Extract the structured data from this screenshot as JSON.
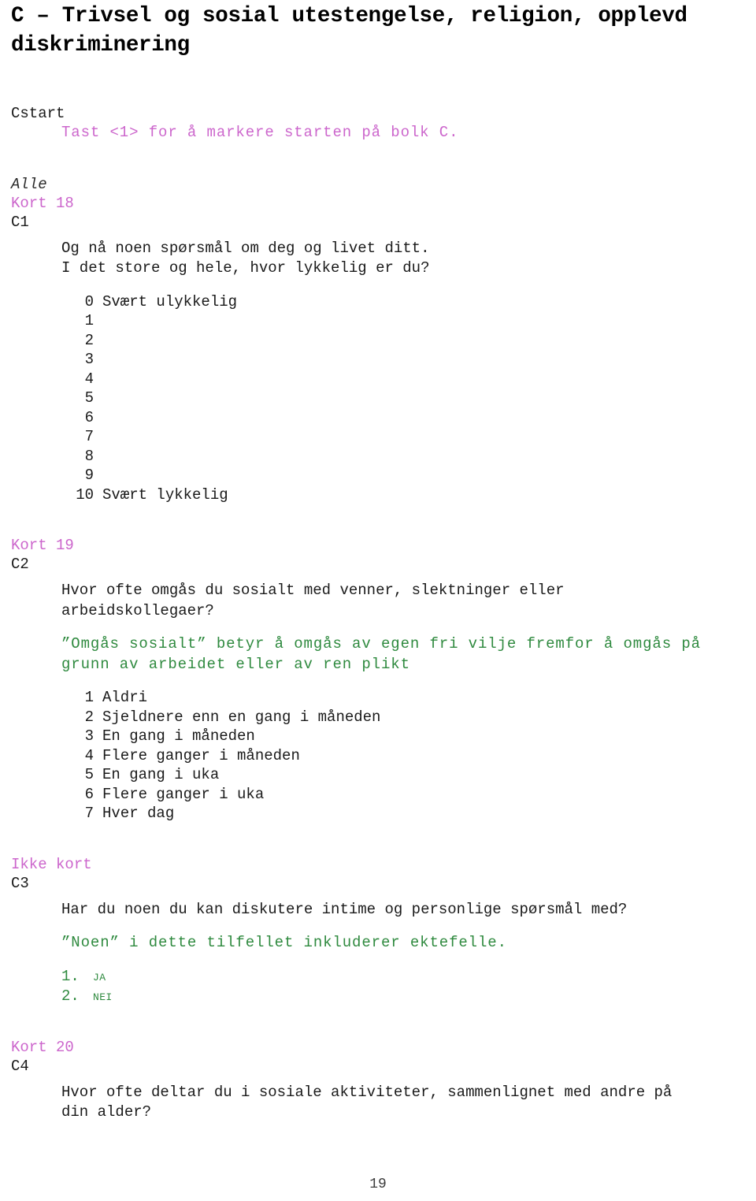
{
  "document": {
    "title": "C – Trivsel og sosial utestengelse, religion, opplevd diskriminering",
    "page_number": "19"
  },
  "colors": {
    "card": "#cc66cc",
    "instruction": "#2f8a3f",
    "body": "#1a1a1a",
    "routing": "#2b2b2b",
    "title": "#000000"
  },
  "blocks": {
    "cstart": {
      "qid": "Cstart",
      "instruction": "Tast <1> for å markere starten på bolk C."
    },
    "c1": {
      "routing": "Alle",
      "card_label": "Kort 18",
      "qid": "C1",
      "question_line_1": "Og nå noen spørsmål om deg og livet ditt.",
      "question_line_2": "I det store og hele, hvor lykkelig er du?",
      "options": [
        {
          "code": "0",
          "label": "Svært ulykkelig"
        },
        {
          "code": "1",
          "label": ""
        },
        {
          "code": "2",
          "label": ""
        },
        {
          "code": "3",
          "label": ""
        },
        {
          "code": "4",
          "label": ""
        },
        {
          "code": "5",
          "label": ""
        },
        {
          "code": "6",
          "label": ""
        },
        {
          "code": "7",
          "label": ""
        },
        {
          "code": "8",
          "label": ""
        },
        {
          "code": "9",
          "label": ""
        },
        {
          "code": "10",
          "label": "Svært lykkelig"
        }
      ]
    },
    "c2": {
      "card_label": "Kort 19",
      "qid": "C2",
      "question": "Hvor ofte omgås du sosialt med venner, slektninger eller\narbeidskollegaer?",
      "instruction": "”Omgås sosialt” betyr å omgås av egen fri vilje fremfor å omgås på\ngrunn av arbeidet eller av ren plikt",
      "options": [
        {
          "code": "1",
          "label": "Aldri"
        },
        {
          "code": "2",
          "label": "Sjeldnere enn en gang i måneden"
        },
        {
          "code": "3",
          "label": "En gang i måneden"
        },
        {
          "code": "4",
          "label": "Flere ganger i måneden"
        },
        {
          "code": "5",
          "label": "En gang i uka"
        },
        {
          "code": "6",
          "label": "Flere ganger i uka"
        },
        {
          "code": "7",
          "label": "Hver dag"
        }
      ]
    },
    "c3": {
      "card_label": "Ikke kort",
      "qid": "C3",
      "question": "Har du noen du kan diskutere intime og personlige spørsmål med?",
      "instruction": "”Noen” i dette tilfellet inkluderer ektefelle.",
      "options": [
        {
          "code": "1.",
          "label": "Ja"
        },
        {
          "code": "2.",
          "label": "Nei"
        }
      ]
    },
    "c4": {
      "card_label": "Kort 20",
      "qid": "C4",
      "question": "Hvor ofte deltar du i sosiale aktiviteter, sammenlignet med andre på\ndin alder?"
    }
  }
}
